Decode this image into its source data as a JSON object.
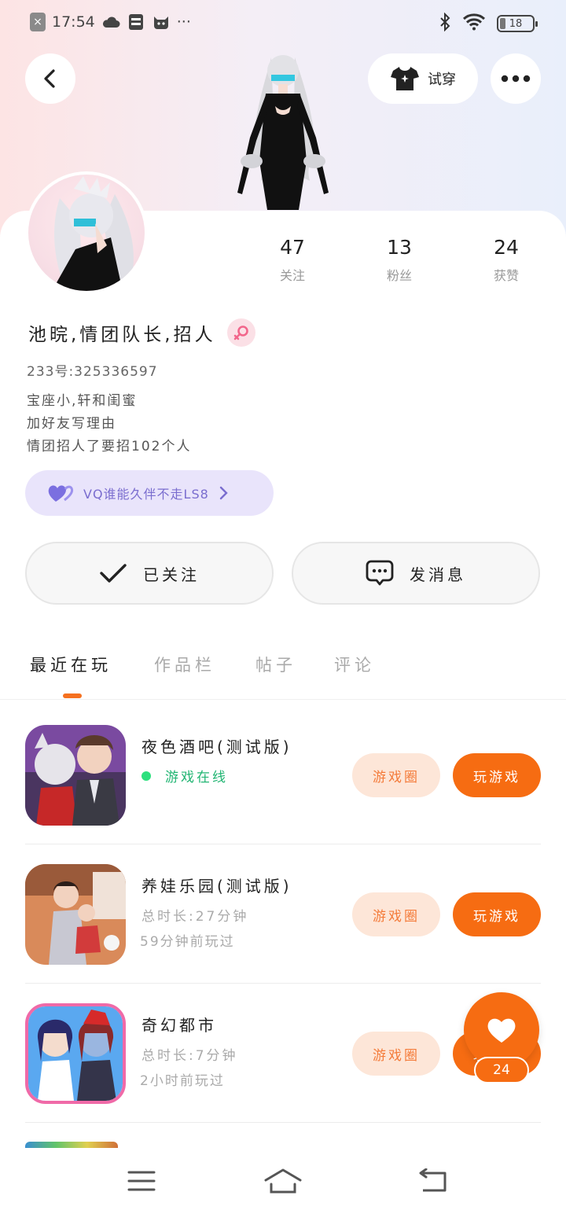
{
  "status_bar": {
    "time": "17:54",
    "x_label": "×",
    "dots": "···",
    "battery": "18",
    "battery_fraction": 0.18
  },
  "header": {
    "tryon_label": "试穿"
  },
  "profile": {
    "name": "池晥,情团队长,招人",
    "uid": "233号:325336597",
    "bio": [
      "宝座小,轩和闺蜜",
      "加好友写理由",
      "情团招人了要招102个人"
    ],
    "vq_label": "VQ谁能久伴不走LS8"
  },
  "stats": [
    {
      "num": "47",
      "label": "关注"
    },
    {
      "num": "13",
      "label": "粉丝"
    },
    {
      "num": "24",
      "label": "获赞"
    }
  ],
  "actions": {
    "follow_label": "已关注",
    "message_label": "发消息"
  },
  "tabs": [
    {
      "label": "最近在玩"
    },
    {
      "label": "作品栏"
    },
    {
      "label": "帖子"
    },
    {
      "label": "评论"
    }
  ],
  "games": [
    {
      "title": "夜色酒吧(测试版)",
      "status": "游戏在线",
      "circle_label": "游戏圈",
      "play_label": "玩游戏"
    },
    {
      "title": "养娃乐园(测试版)",
      "duration": "总时长:27分钟",
      "last_played": "59分钟前玩过",
      "circle_label": "游戏圈",
      "play_label": "玩游戏"
    },
    {
      "title": "奇幻都市",
      "duration": "总时长:7分钟",
      "last_played": "2小时前玩过",
      "circle_label": "游戏圈",
      "play_label": "玩游戏"
    }
  ],
  "like_fab": {
    "count": "24"
  },
  "colors": {
    "accent": "#f66c12",
    "accent_light": "#fde6d8",
    "vq_bg": "#e9e4fb",
    "vq_text": "#7a6dcf",
    "online": "#22b573"
  }
}
